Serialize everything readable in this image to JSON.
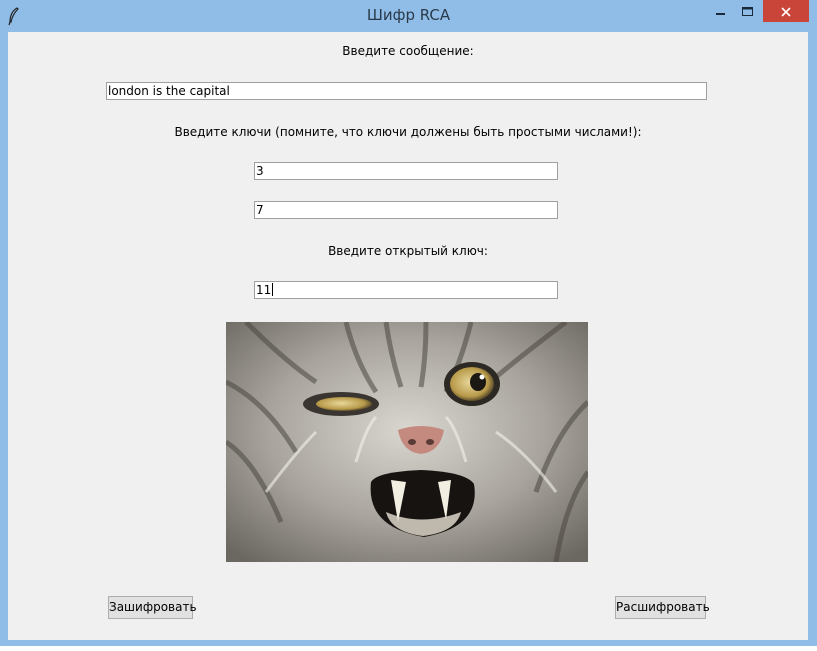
{
  "window": {
    "title": "Шифр RCA",
    "icons": [
      "feather-icon",
      "minimize-icon",
      "maximize-icon",
      "close-icon"
    ]
  },
  "form": {
    "message_label": "Введите сообщение:",
    "message_value": "london is the capital",
    "keys_label": "Введите ключи (помните, что ключи должены быть простыми числами!):",
    "key1_value": "3",
    "key2_value": "7",
    "open_key_label": "Введите открытый ключ:",
    "open_key_value": "11"
  },
  "buttons": {
    "encrypt": "Зашифровать",
    "decrypt": "Расшифровать"
  },
  "colors": {
    "titlebar": "#8fbde8",
    "client_bg": "#f0f0f0",
    "close_button": "#c9453a"
  }
}
